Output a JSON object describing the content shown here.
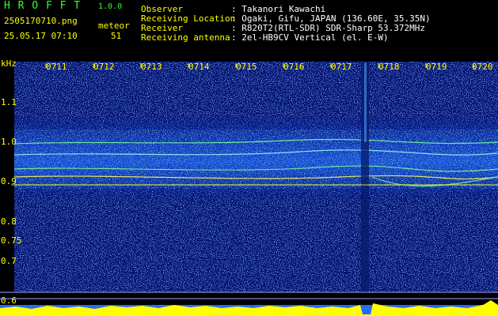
{
  "header": {
    "app_name": "H R O F F T",
    "version": "1.0.0",
    "filename": "2505170710.png",
    "datetime": "25.05.17 07:10",
    "meteor_label": "meteor",
    "meteor_count": "51",
    "info_labels": [
      "Observer",
      "Receiving Location",
      "Receiver",
      "Receiving antenna"
    ],
    "info_values": [
      ": Takanori Kawachi",
      ": Ogaki, Gifu, JAPAN (136.60E, 35.35N)",
      ": R820T2(RTL-SDR) SDR-Sharp 53.372MHz",
      ": 2el-HB9CV Vertical (el. E-W)"
    ]
  },
  "chart_data": {
    "type": "heatmap",
    "ylabel": "kHz",
    "time_ticks": [
      "0711",
      "0712",
      "0713",
      "0714",
      "0715",
      "0716",
      "0717",
      "0718",
      "0719",
      "0720"
    ],
    "freq_ticks": [
      "1.1",
      "1.0",
      "0.9",
      "0.8",
      "0.75",
      "0.7",
      "0.6"
    ],
    "colors": {
      "background": "#000000",
      "label": "#ffff00",
      "info": "#ffffff",
      "version": "#33ff33"
    }
  }
}
